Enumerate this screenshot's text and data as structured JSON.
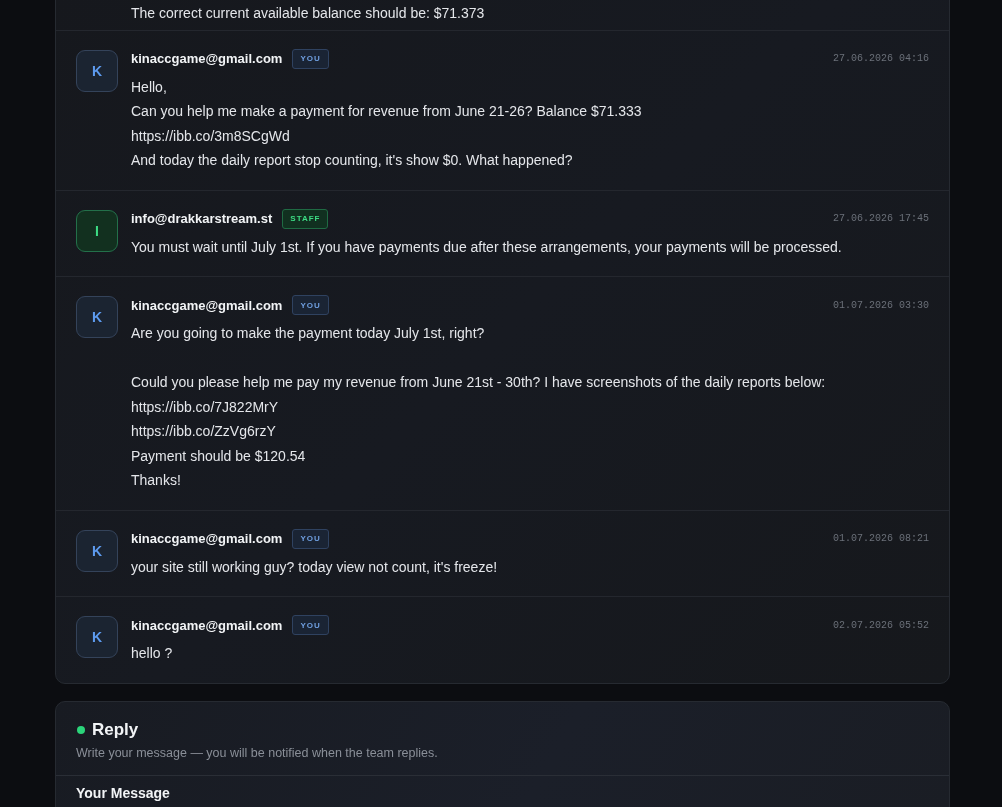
{
  "thread": {
    "messages": [
      {
        "body": "The correct current available balance should be: $71.373"
      },
      {
        "kind": "user",
        "avatar": "K",
        "author": "kinaccgame@gmail.com",
        "badge": "YOU",
        "time": "27.06.2026 04:16",
        "body": "Hello,\nCan you help me make a payment for revenue from June 21-26? Balance $71.333\nhttps://ibb.co/3m8SCgWd\nAnd today the daily report stop counting, it's show $0. What happened?"
      },
      {
        "kind": "staff",
        "avatar": "I",
        "author": "info@drakkarstream.st",
        "badge": "STAFF",
        "time": "27.06.2026 17:45",
        "body": "You must wait until July 1st. If you have payments due after these arrangements, your payments will be processed."
      },
      {
        "kind": "user",
        "avatar": "K",
        "author": "kinaccgame@gmail.com",
        "badge": "YOU",
        "time": "01.07.2026 03:30",
        "body": "Are you going to make the payment today July 1st, right?\n\nCould you please help me pay my revenue from June 21st - 30th? I have screenshots of the daily reports below:\nhttps://ibb.co/7J822MrY\nhttps://ibb.co/ZzVg6rzY\nPayment should be $120.54\nThanks!"
      },
      {
        "kind": "user",
        "avatar": "K",
        "author": "kinaccgame@gmail.com",
        "badge": "YOU",
        "time": "01.07.2026 08:21",
        "body": "your site still working guy? today view not count, it's freeze!"
      },
      {
        "kind": "user",
        "avatar": "K",
        "author": "kinaccgame@gmail.com",
        "badge": "YOU",
        "time": "02.07.2026 05:52",
        "body": "hello ?"
      }
    ]
  },
  "reply": {
    "title": "Reply",
    "hint": "Write your message — you will be notified when the team replies.",
    "field_label": "Your Message"
  }
}
